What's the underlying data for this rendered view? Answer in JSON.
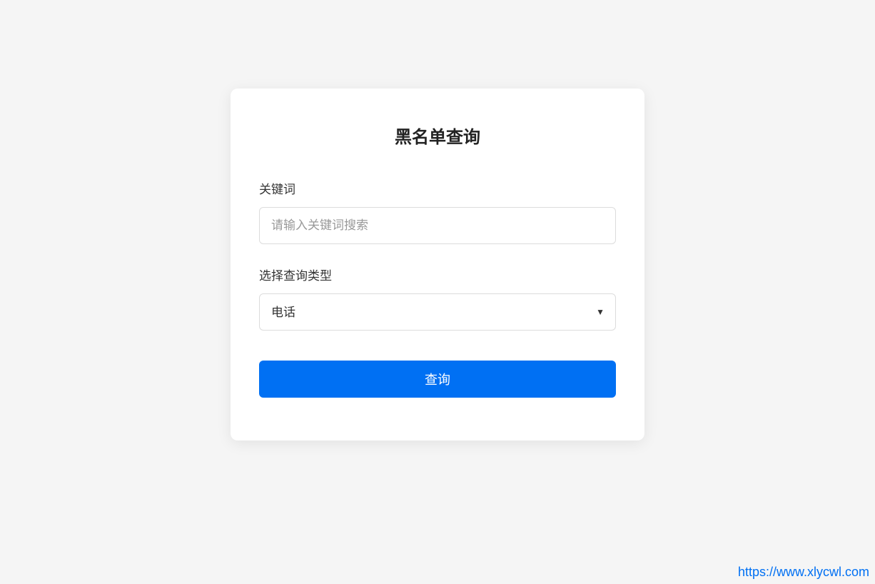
{
  "card": {
    "title": "黑名单查询",
    "keyword": {
      "label": "关键词",
      "placeholder": "请输入关键词搜索"
    },
    "queryType": {
      "label": "选择查询类型",
      "selected": "电话"
    },
    "submitButton": "查询"
  },
  "footer": {
    "linkText": "https://www.xlycwl.com"
  }
}
